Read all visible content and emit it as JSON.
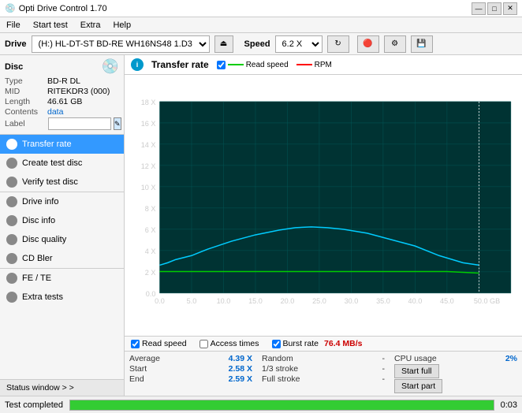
{
  "titlebar": {
    "icon": "💿",
    "title": "Opti Drive Control 1.70",
    "minimize": "—",
    "restore": "□",
    "close": "✕"
  },
  "menubar": {
    "items": [
      "File",
      "Start test",
      "Extra",
      "Help"
    ]
  },
  "drivebar": {
    "drive_label": "Drive",
    "drive_value": "(H:)  HL-DT-ST BD-RE  WH16NS48 1.D3",
    "speed_label": "Speed",
    "speed_value": "6.2 X"
  },
  "disc": {
    "type_label": "Type",
    "type_value": "BD-R DL",
    "mid_label": "MID",
    "mid_value": "RITEKDR3 (000)",
    "length_label": "Length",
    "length_value": "46.61 GB",
    "contents_label": "Contents",
    "contents_value": "data",
    "label_label": "Label"
  },
  "nav": {
    "items": [
      {
        "id": "transfer-rate",
        "label": "Transfer rate",
        "active": true
      },
      {
        "id": "create-test-disc",
        "label": "Create test disc",
        "active": false
      },
      {
        "id": "verify-test-disc",
        "label": "Verify test disc",
        "active": false
      },
      {
        "id": "drive-info",
        "label": "Drive info",
        "active": false
      },
      {
        "id": "disc-info",
        "label": "Disc info",
        "active": false
      },
      {
        "id": "disc-quality",
        "label": "Disc quality",
        "active": false
      },
      {
        "id": "cd-bler",
        "label": "CD Bler",
        "active": false
      },
      {
        "id": "fe-te",
        "label": "FE / TE",
        "active": false
      },
      {
        "id": "extra-tests",
        "label": "Extra tests",
        "active": false
      }
    ],
    "status_window": "Status window > >"
  },
  "chart": {
    "title": "Transfer rate",
    "legend": {
      "read_speed": "Read speed",
      "rpm": "RPM"
    },
    "y_axis": [
      "18 X",
      "16 X",
      "14 X",
      "12 X",
      "10 X",
      "8 X",
      "6 X",
      "4 X",
      "2 X",
      "0.0"
    ],
    "x_axis": [
      "0.0",
      "5.0",
      "10.0",
      "15.0",
      "20.0",
      "25.0",
      "30.0",
      "35.0",
      "40.0",
      "45.0",
      "50.0 GB"
    ]
  },
  "checkboxes": {
    "read_speed": {
      "label": "Read speed",
      "checked": true
    },
    "access_times": {
      "label": "Access times",
      "checked": false
    },
    "burst_rate": {
      "label": "Burst rate",
      "checked": true,
      "value": "76.4 MB/s"
    }
  },
  "stats": {
    "average_label": "Average",
    "average_value": "4.39 X",
    "random_label": "Random",
    "random_value": "-",
    "cpu_label": "CPU usage",
    "cpu_value": "2%",
    "start_label": "Start",
    "start_value": "2.58 X",
    "stroke1_label": "1/3 stroke",
    "stroke1_value": "-",
    "start_full_btn": "Start full",
    "end_label": "End",
    "end_value": "2.59 X",
    "full_stroke_label": "Full stroke",
    "full_stroke_value": "-",
    "start_part_btn": "Start part"
  },
  "statusbar": {
    "text": "Test completed",
    "progress": 100,
    "time": "0:03"
  }
}
